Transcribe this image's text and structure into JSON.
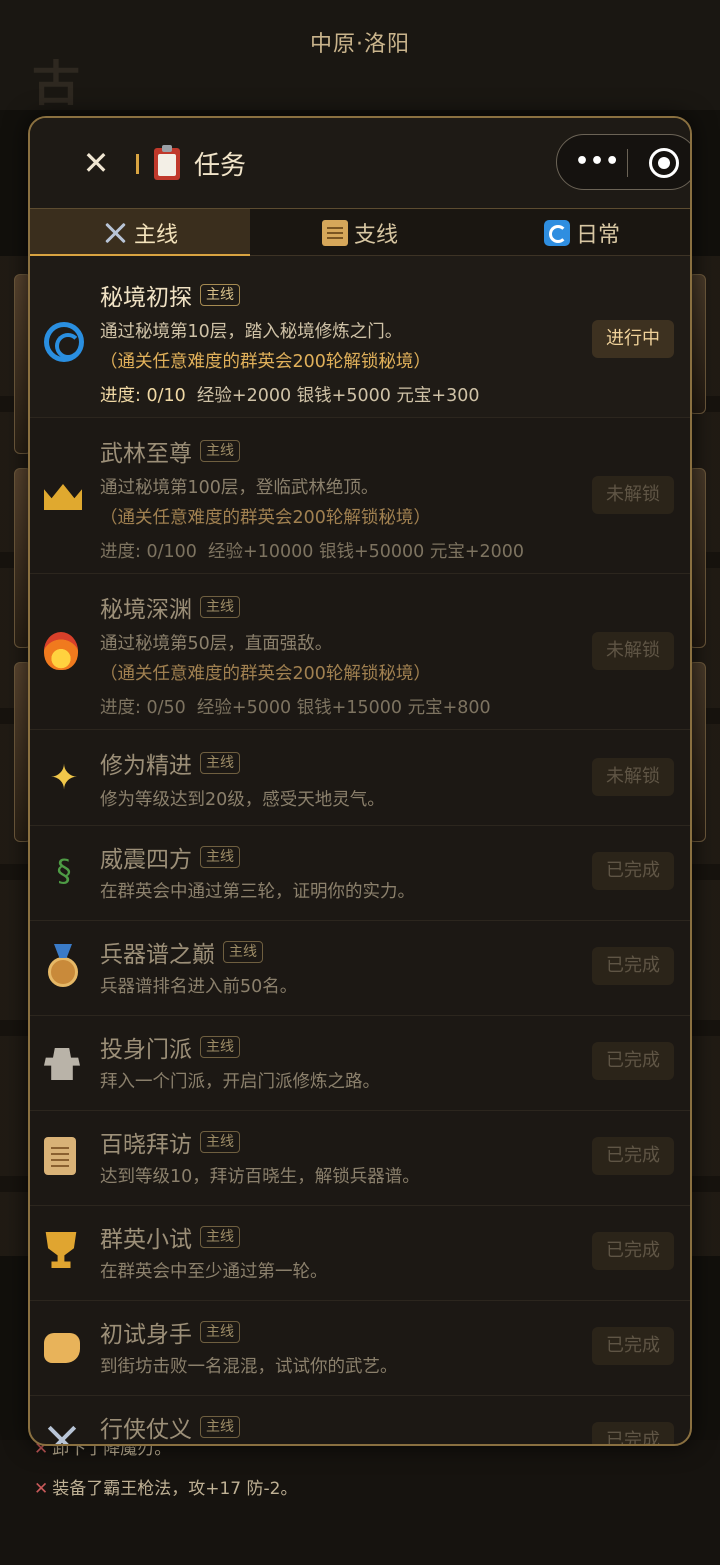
{
  "background": {
    "location": "中原·洛阳",
    "corner_char": "古",
    "log_lines": [
      {
        "icon": "crossed-swords",
        "text": "卸下了降魔刃。"
      },
      {
        "icon": "crossed-swords",
        "text": "装备了霸王枪法，攻+17 防-2。"
      }
    ]
  },
  "header": {
    "title": "任务",
    "title_icon": "clipboard-icon"
  },
  "tabs": [
    {
      "label": "主线",
      "icon": "crossed-swords-icon",
      "active": true
    },
    {
      "label": "支线",
      "icon": "scroll-icon",
      "active": false
    },
    {
      "label": "日常",
      "icon": "refresh-icon",
      "active": false
    }
  ],
  "tasks": [
    {
      "title": "秘境初探",
      "tag": "主线",
      "icon": "spiral-icon",
      "desc": "通过秘境第10层，踏入秘境修炼之门。",
      "note": "（通关任意难度的群英会200轮解锁秘境）",
      "progress_label": "进度: 0/10",
      "rewards": "经验+2000  银钱+5000  元宝+300",
      "status": "进行中"
    },
    {
      "title": "武林至尊",
      "tag": "主线",
      "icon": "crown-icon",
      "desc": "通过秘境第100层，登临武林绝顶。",
      "note": "（通关任意难度的群英会200轮解锁秘境）",
      "progress_label": "进度: 0/100",
      "rewards": "经验+10000  银钱+50000  元宝+2000",
      "status": "未解锁"
    },
    {
      "title": "秘境深渊",
      "tag": "主线",
      "icon": "fire-icon",
      "desc": "通过秘境第50层，直面强敌。",
      "note": "（通关任意难度的群英会200轮解锁秘境）",
      "progress_label": "进度: 0/50",
      "rewards": "经验+5000  银钱+15000  元宝+800",
      "status": "未解锁"
    },
    {
      "title": "修为精进",
      "tag": "主线",
      "icon": "sparkles-icon",
      "desc": "修为等级达到20级，感受天地灵气。",
      "status": "未解锁"
    },
    {
      "title": "威震四方",
      "tag": "主线",
      "icon": "dragon-icon",
      "desc": "在群英会中通过第三轮，证明你的实力。",
      "status": "已完成"
    },
    {
      "title": "兵器谱之巅",
      "tag": "主线",
      "icon": "medal-icon",
      "desc": "兵器谱排名进入前50名。",
      "status": "已完成"
    },
    {
      "title": "投身门派",
      "tag": "主线",
      "icon": "castle-icon",
      "desc": "拜入一个门派，开启门派修炼之路。",
      "status": "已完成"
    },
    {
      "title": "百晓拜访",
      "tag": "主线",
      "icon": "scroll-icon",
      "desc": "达到等级10，拜访百晓生，解锁兵器谱。",
      "status": "已完成"
    },
    {
      "title": "群英小试",
      "tag": "主线",
      "icon": "trophy-icon",
      "desc": "在群英会中至少通过第一轮。",
      "status": "已完成"
    },
    {
      "title": "初试身手",
      "tag": "主线",
      "icon": "fist-icon",
      "desc": "到街坊击败一名混混，试试你的武艺。",
      "status": "已完成"
    },
    {
      "title": "行侠仗义",
      "tag": "主线",
      "icon": "crossed-swords-icon",
      "desc": "",
      "status": "已完成"
    }
  ]
}
